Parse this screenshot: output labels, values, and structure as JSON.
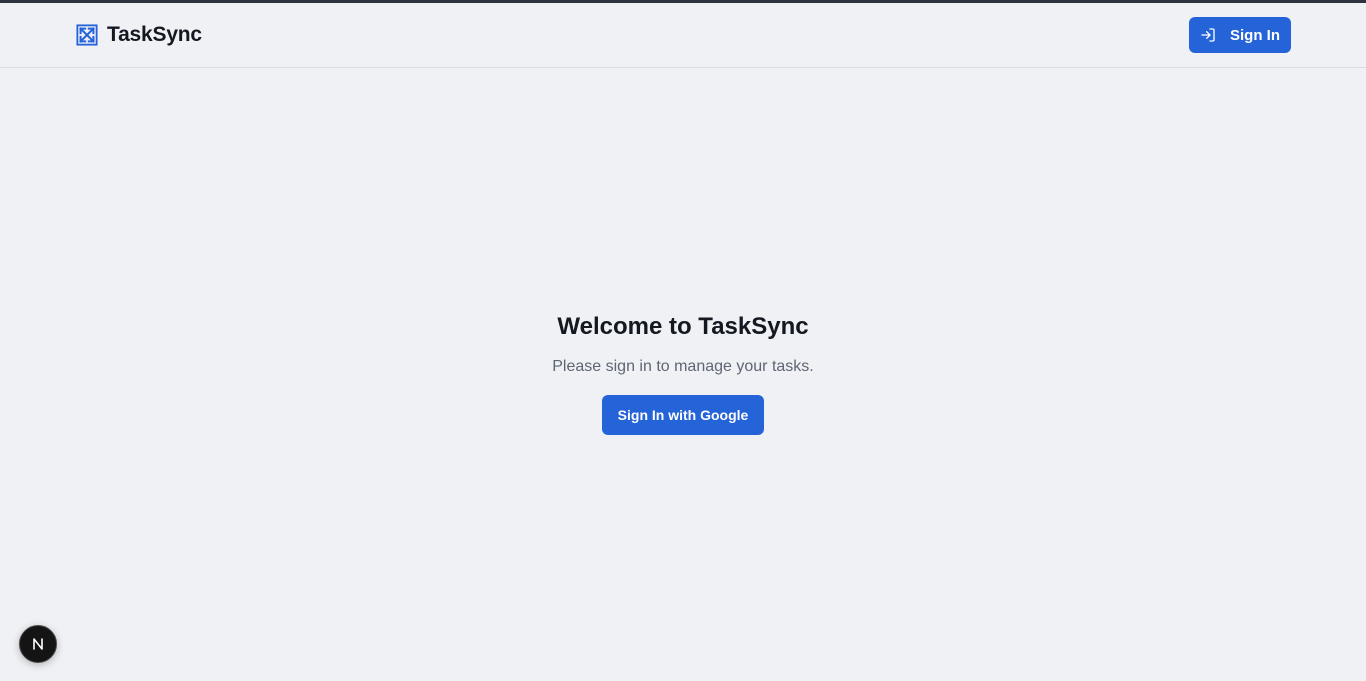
{
  "app": {
    "name": "TaskSync",
    "accent_color": "#2563d9"
  },
  "header": {
    "logo_icon": "expand-arrows-icon",
    "signin_icon": "log-in-icon",
    "signin_label": "Sign In"
  },
  "main": {
    "title": "Welcome to TaskSync",
    "subtitle": "Please sign in to manage your tasks.",
    "google_button_label": "Sign In with Google"
  },
  "dev_badge": {
    "icon": "nextjs-logo-icon"
  }
}
